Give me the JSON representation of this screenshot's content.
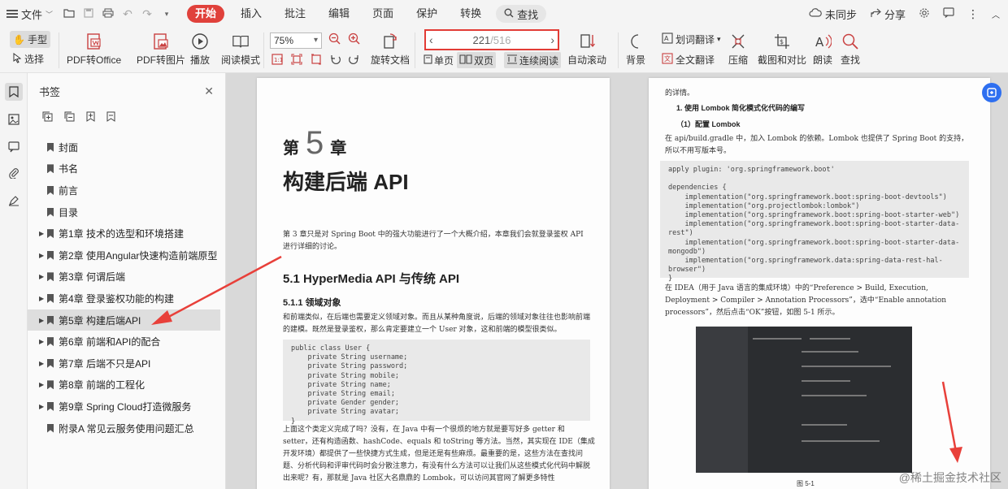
{
  "menu": {
    "file_label": "文件",
    "tabs": [
      {
        "label": "开始",
        "active": true
      },
      {
        "label": "插入",
        "active": false
      },
      {
        "label": "批注",
        "active": false
      },
      {
        "label": "编辑",
        "active": false
      },
      {
        "label": "页面",
        "active": false
      },
      {
        "label": "保护",
        "active": false
      },
      {
        "label": "转换",
        "active": false
      }
    ],
    "search_label": "查找",
    "sync_label": "未同步",
    "share_label": "分享",
    "accent_color": "#e0413b"
  },
  "toolbar": {
    "hand_label": "手型",
    "select_label": "选择",
    "pdf_to_office": "PDF转Office",
    "pdf_to_image": "PDF转图片",
    "play": "播放",
    "read_mode": "阅读模式",
    "zoom_value": "75%",
    "rotate_doc": "旋转文档",
    "page_current": "221",
    "page_total": "/516",
    "single_page": "单页",
    "double_page": "双页",
    "continuous": "连续阅读",
    "auto_scroll": "自动滚动",
    "background": "背景",
    "word_translate": "划词翻译",
    "full_translate": "全文翻译",
    "compress": "压缩",
    "screenshot_compare": "截图和对比",
    "read_aloud": "朗读",
    "find": "查找"
  },
  "bookmarks": {
    "title": "书签",
    "items": [
      {
        "label": "封面",
        "expandable": false,
        "selected": false
      },
      {
        "label": "书名",
        "expandable": false,
        "selected": false
      },
      {
        "label": "前言",
        "expandable": false,
        "selected": false
      },
      {
        "label": "目录",
        "expandable": false,
        "selected": false
      },
      {
        "label": "第1章 技术的选型和环境搭建",
        "expandable": true,
        "selected": false
      },
      {
        "label": "第2章 使用Angular快速构造前端原型",
        "expandable": true,
        "selected": false
      },
      {
        "label": "第3章 何谓后端",
        "expandable": true,
        "selected": false
      },
      {
        "label": "第4章 登录鉴权功能的构建",
        "expandable": true,
        "selected": false
      },
      {
        "label": "第5章 构建后端API",
        "expandable": true,
        "selected": true
      },
      {
        "label": "第6章 前端和API的配合",
        "expandable": true,
        "selected": false
      },
      {
        "label": "第7章 后端不只是API",
        "expandable": true,
        "selected": false
      },
      {
        "label": "第8章 前端的工程化",
        "expandable": true,
        "selected": false
      },
      {
        "label": "第9章 Spring Cloud打造微服务",
        "expandable": true,
        "selected": false
      },
      {
        "label": "附录A 常见云服务使用问题汇总",
        "expandable": false,
        "selected": false
      }
    ]
  },
  "page_left": {
    "chapter_prefix": "第",
    "chapter_num": "5",
    "chapter_suffix": "章",
    "chapter_title": "构建后端 API",
    "intro": "第 3 章只是对 Spring Boot 中的强大功能进行了一个大概介绍，本章我们会就登录鉴权 API 进行详细的讨论。",
    "section_title": "5.1  HyperMedia API 与传统 API",
    "subsection_title": "5.1.1  领域对象",
    "para1": "和前端类似，在后端也需要定义领域对象。而且从某种角度说，后端的领域对象往往也影响前端的建模。既然是登录鉴权，那么肯定要建立一个 User 对象，这和前端的模型很类似。",
    "code": "public class User {\n    private String username;\n    private String password;\n    private String mobile;\n    private String name;\n    private String email;\n    private Gender gender;\n    private String avatar;\n}",
    "para2": "上面这个类定义完成了吗？没有，在 Java 中有一个很烦的地方就是要写好多 getter 和 setter，还有构造函数、hashCode、equals 和 toString 等方法。当然，其实现在 IDE（集成开发环境）都提供了一些快捷方式生成，但是还是有些麻烦。最重要的是，这些方法在查找问题、分析代码和评审代码时会分散注意力，有没有什么方法可以让我们从这些模式化代码中解脱出来呢？有，那就是 Java 社区大名鼎鼎的 Lombok，可以访问其官网了解更多特性"
  },
  "page_right": {
    "top_text": "的详情。",
    "heading1": "1.  使用 Lombok 简化模式化代码的编写",
    "heading2": "（1）配置 Lombok",
    "para3": "在 api/build.gradle 中，加入 Lombok 的依赖。Lombok 也提供了 Spring Boot 的支持，所以不用写版本号。",
    "code": "apply plugin: 'org.springframework.boot'\n\ndependencies {\n    implementation(\"org.springframework.boot:spring-boot-devtools\")\n    implementation(\"org.projectlombok:lombok\")\n    implementation(\"org.springframework.boot:spring-boot-starter-web\")\n    implementation(\"org.springframework.boot:spring-boot-starter-data-\nrest\")\n    implementation(\"org.springframework.boot:spring-boot-starter-data-\nmongodb\")\n    implementation(\"org.springframework.data:spring-data-rest-hal-\nbrowser\")\n}",
    "para4": "在 IDEA（用于 Java 语言的集成环境）中的“Preference > Build, Execution, Deployment > Compiler > Annotation Processors”，选中“Enable annotation processors”，然后点击“OK”按钮，如图 5-1 所示。",
    "caption": "图 5-1"
  },
  "watermark": "@稀土掘金技术社区"
}
